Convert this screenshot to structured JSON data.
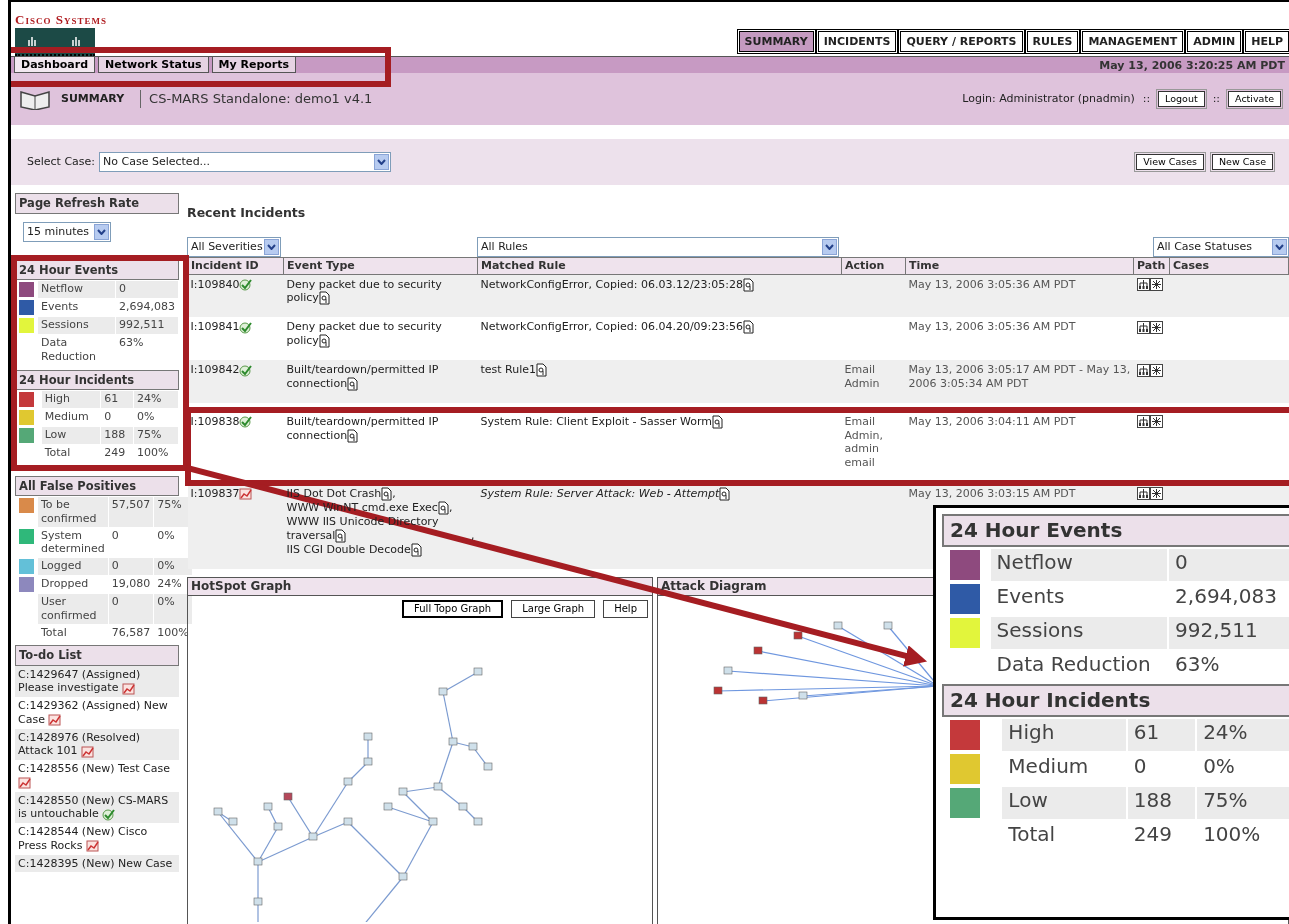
{
  "logo": {
    "text": "Cisco Systems"
  },
  "nav_tabs": [
    {
      "label": "SUMMARY",
      "selected": true
    },
    {
      "label": "INCIDENTS",
      "selected": false
    },
    {
      "label": "QUERY / REPORTS",
      "selected": false
    },
    {
      "label": "RULES",
      "selected": false
    },
    {
      "label": "MANAGEMENT",
      "selected": false
    },
    {
      "label": "ADMIN",
      "selected": false
    },
    {
      "label": "HELP",
      "selected": false
    }
  ],
  "sub_tabs": [
    {
      "label": "Dashboard",
      "selected": true
    },
    {
      "label": "Network Status",
      "selected": false
    },
    {
      "label": "My Reports",
      "selected": false
    }
  ],
  "datetime": "May 13, 2006 3:20:25 AM PDT",
  "page_title": {
    "section": "SUMMARY",
    "title": "CS-MARS Standalone: demo1 v4.1"
  },
  "login": {
    "text": "Login: Administrator (pnadmin)",
    "items": [
      {
        "separator": "::",
        "button": "Logout"
      },
      {
        "separator": "::",
        "button": "Activate"
      }
    ]
  },
  "case_bar": {
    "label": "Select Case:",
    "value": "No Case Selected...",
    "buttons": [
      "View Cases",
      "New Case"
    ]
  },
  "sidebar": {
    "refresh": {
      "title": "Page Refresh Rate",
      "value": "15 minutes"
    },
    "events": {
      "title": "24 Hour Events",
      "rows": [
        {
          "label": "Netflow",
          "count": "0",
          "color": "#8e4a7e"
        },
        {
          "label": "Events",
          "count": "2,694,083",
          "color": "#2f5aa6"
        },
        {
          "label": "Sessions",
          "count": "992,511",
          "color": "#e2f53c"
        },
        {
          "label": "Data Reduction",
          "count": "63%"
        }
      ]
    },
    "incidents": {
      "title": "24 Hour Incidents",
      "rows": [
        {
          "label": "High",
          "count": "61",
          "percent": "24%",
          "color": "#c4393b"
        },
        {
          "label": "Medium",
          "count": "0",
          "percent": "0%",
          "color": "#e0c830"
        },
        {
          "label": "Low",
          "count": "188",
          "percent": "75%",
          "color": "#55a877"
        },
        {
          "label": "Total",
          "count": "249",
          "percent": "100%"
        }
      ]
    },
    "false_positives": {
      "title": "All False Positives",
      "rows": [
        {
          "label": "To be confirmed",
          "count": "57,507",
          "percent": "75%",
          "color": "#d98a4a"
        },
        {
          "label": "System determined",
          "count": "0",
          "percent": "0%",
          "color": "#2fb87a"
        },
        {
          "label": "Logged",
          "count": "0",
          "percent": "0%",
          "color": "#63c0d8"
        },
        {
          "label": "Dropped",
          "count": "19,080",
          "percent": "24%",
          "color": "#8d88bd"
        },
        {
          "label": "User confirmed",
          "count": "0",
          "percent": "0%"
        },
        {
          "label": "Total",
          "count": "76,587",
          "percent": "100%"
        }
      ]
    },
    "todo": {
      "title": "To-do List",
      "items": [
        {
          "text": "C:1429647 (Assigned) Please investigate",
          "kind": "graph"
        },
        {
          "text": "C:1429362 (Assigned) New Case",
          "kind": "graph"
        },
        {
          "text": "C:1428976 (Resolved) Attack 101",
          "kind": "graph"
        },
        {
          "text": "C:1428556 (New) Test Case",
          "kind": "graph"
        },
        {
          "text": "C:1428550 (New) CS-MARS is untouchable",
          "kind": "check"
        },
        {
          "text": "C:1428544 (New) Cisco Press Rocks",
          "kind": "graph"
        },
        {
          "text": "C:1428395 (New) New Case"
        }
      ]
    }
  },
  "recent_incidents": {
    "title": "Recent Incidents",
    "filters": [
      "All Severities",
      "All Rules",
      "All Case Statuses"
    ],
    "columns": [
      "Incident ID",
      "Event Type",
      "Matched Rule",
      "Action",
      "Time",
      "Path",
      "Cases"
    ],
    "rows": [
      {
        "id": "I:109840",
        "kind": "check",
        "events": [
          "Deny packet due to security policy"
        ],
        "rule": "NetworkConfigError, Copied: 06.03.12/23:05:28",
        "italic": false,
        "time": "May 13, 2006 3:05:36 AM PDT"
      },
      {
        "id": "I:109841",
        "kind": "check",
        "events": [
          "Deny packet due to security policy"
        ],
        "rule": "NetworkConfigError, Copied: 06.04.20/09:23:56",
        "italic": false,
        "time": "May 13, 2006 3:05:36 AM PDT"
      },
      {
        "id": "I:109842",
        "kind": "check",
        "events": [
          "Built/teardown/permitted IP connection"
        ],
        "rule": "test Rule1",
        "italic": false,
        "action": "Email Admin",
        "time": "May 13, 2006 3:05:17 AM PDT - May 13, 2006 3:05:34 AM PDT"
      },
      {
        "id": "I:109838",
        "kind": "check",
        "events": [
          "Built/teardown/permitted IP connection"
        ],
        "rule": "System Rule: Client Exploit - Sasser Worm",
        "italic": false,
        "action": "Email Admin, admin email",
        "time": "May 13, 2006 3:04:11 AM PDT"
      },
      {
        "id": "I:109837",
        "kind": "graph",
        "event_separator": ",",
        "events": [
          "IIS Dot Dot Crash",
          "WWW WinNT cmd.exe Exec",
          "WWW IIS Unicode Directory traversal",
          "IIS CGI Double Decode"
        ],
        "rule": "System Rule: Server Attack: Web - Attempt",
        "italic": true,
        "time": "May 13, 2006 3:03:15 AM PDT"
      }
    ]
  },
  "hotspot": {
    "title": "HotSpot Graph",
    "buttons": [
      {
        "label": "Full Topo Graph",
        "selected": true
      },
      {
        "label": "Large Graph",
        "selected": false
      },
      {
        "label": "Help",
        "selected": false
      }
    ]
  },
  "attack_diagram": {
    "title": "Attack Diagram"
  },
  "zoom_inset": {
    "events": {
      "title": "24 Hour Events",
      "rows": [
        {
          "label": "Netflow",
          "count": "0",
          "color": "#8e4a7e"
        },
        {
          "label": "Events",
          "count": "2,694,083",
          "color": "#2f5aa6"
        },
        {
          "label": "Sessions",
          "count": "992,511",
          "color": "#e2f53c"
        },
        {
          "label": "Data Reduction",
          "count": "63%"
        }
      ]
    },
    "incidents": {
      "title": "24 Hour Incidents",
      "rows": [
        {
          "label": "High",
          "count": "61",
          "percent": "24%",
          "color": "#c4393b"
        },
        {
          "label": "Medium",
          "count": "0",
          "percent": "0%",
          "color": "#e0c830"
        },
        {
          "label": "Low",
          "count": "188",
          "percent": "75%",
          "color": "#55a877"
        },
        {
          "label": "Total",
          "count": "249",
          "percent": "100%"
        }
      ]
    }
  }
}
